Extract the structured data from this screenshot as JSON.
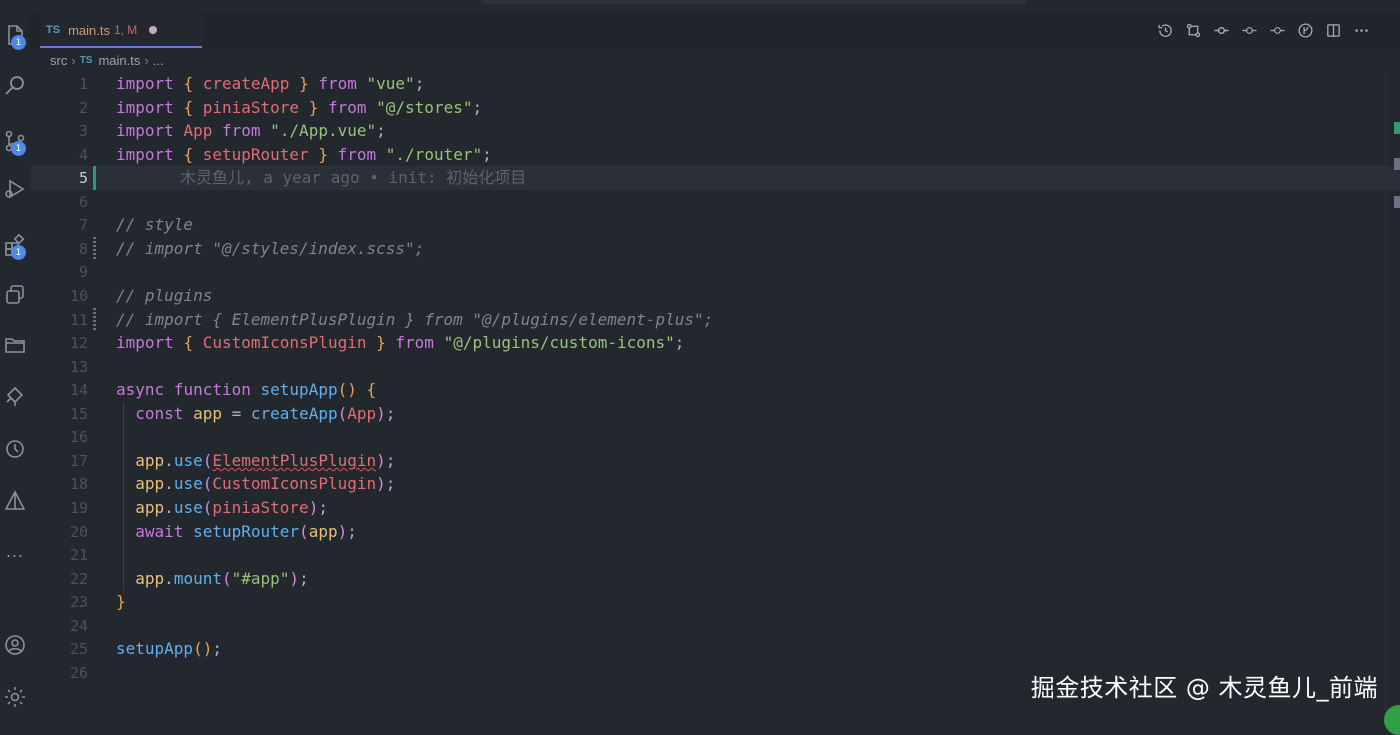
{
  "activity": {
    "explorer_badge": "1",
    "scm_badge": "1",
    "extensions_badge": "1",
    "more": "..."
  },
  "tab": {
    "lang": "TS",
    "name": "main.ts",
    "status": "1, M"
  },
  "breadcrumb": {
    "folder": "src",
    "lang": "TS",
    "file": "main.ts",
    "tail": "..."
  },
  "editor": {
    "blame": "木灵鱼儿, a year ago • init: 初始化项目",
    "line_numbers": [
      "1",
      "2",
      "3",
      "4",
      "5",
      "6",
      "7",
      "8",
      "9",
      "10",
      "11",
      "12",
      "13",
      "14",
      "15",
      "16",
      "17",
      "18",
      "19",
      "20",
      "21",
      "22",
      "23",
      "24",
      "25",
      "26"
    ]
  },
  "watermark": "掘金技术社区 @ 木灵鱼儿_前端",
  "colors": {
    "keyword": "#c678dd",
    "string": "#98c379",
    "function": "#61afef",
    "variable": "#e5c07b",
    "comment": "#7f848e",
    "bracket": "#e5a25a",
    "badge": "#4d8ae8"
  }
}
